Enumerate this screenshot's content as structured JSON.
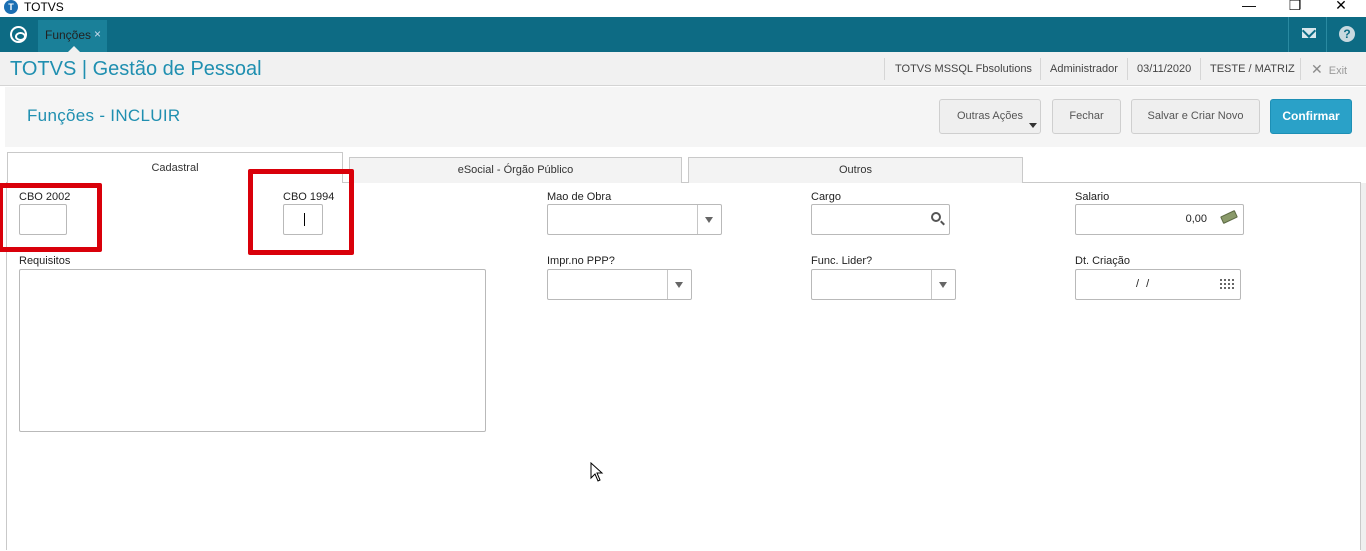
{
  "window": {
    "title": "TOTVS"
  },
  "appbar": {
    "tab_label": "Funções",
    "tab_close": "×",
    "help_glyph": "?"
  },
  "module": {
    "title": "TOTVS | Gestão de Pessoal",
    "server": "TOTVS  MSSQL Fbsolutions",
    "user": "Administrador",
    "date": "03/11/2020",
    "company": "TESTE / MATRIZ",
    "exit_label": "Exit"
  },
  "page": {
    "title": "Funções - INCLUIR",
    "buttons": {
      "other_actions": "Outras Ações",
      "close": "Fechar",
      "save_new": "Salvar e Criar Novo",
      "confirm": "Confirmar"
    }
  },
  "tabs": [
    "Cadastral",
    "eSocial - Órgão Público",
    "Outros"
  ],
  "fields": {
    "cbo2002": {
      "label": "CBO 2002",
      "value": ""
    },
    "cbo1994": {
      "label": "CBO 1994",
      "value": ""
    },
    "mao_obra": {
      "label": "Mao de Obra",
      "value": ""
    },
    "cargo": {
      "label": "Cargo",
      "value": ""
    },
    "salario": {
      "label": "Salario",
      "value": "0,00"
    },
    "requisitos": {
      "label": "Requisitos",
      "value": ""
    },
    "impr_ppp": {
      "label": "Impr.no PPP?",
      "value": ""
    },
    "func_lider": {
      "label": "Func. Lider?",
      "value": ""
    },
    "dt_criacao": {
      "label": "Dt. Criação",
      "value": "/ /"
    }
  },
  "colors": {
    "appbar": "#0d6b84",
    "accent": "#1f8fb0",
    "primary_button": "#2aa1c8",
    "highlight": "#d9000a"
  }
}
